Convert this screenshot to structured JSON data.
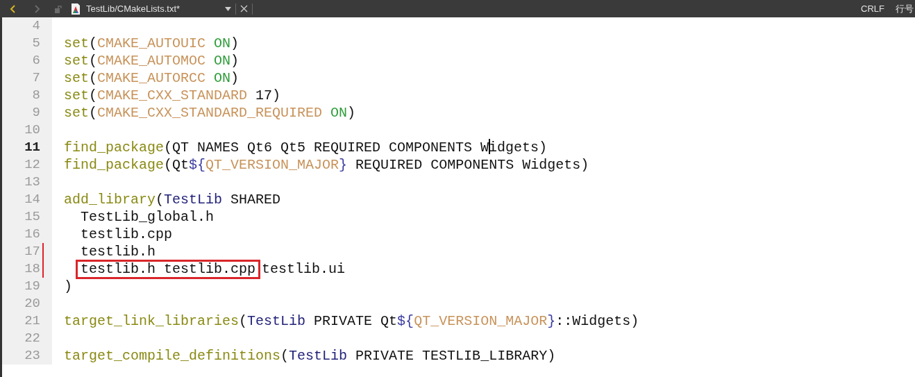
{
  "tab": {
    "title": "TestLib/CMakeLists.txt*",
    "back_enabled": true,
    "forward_enabled": false
  },
  "status": [
    "CRLF",
    "行号"
  ],
  "lines": [
    {
      "number": "4",
      "current": false,
      "changed": false
    },
    {
      "number": "5",
      "current": false,
      "changed": false,
      "tokens": [
        {
          "text": "set",
          "kind": "command"
        },
        {
          "text": "(",
          "kind": "plain"
        },
        {
          "text": "CMAKE_AUTOUIC",
          "kind": "variable"
        },
        {
          "text": " ON",
          "kind": "constant"
        },
        {
          "text": ")",
          "kind": "plain"
        }
      ]
    },
    {
      "number": "6",
      "current": false,
      "changed": false,
      "tokens": [
        {
          "text": "set",
          "kind": "command"
        },
        {
          "text": "(",
          "kind": "plain"
        },
        {
          "text": "CMAKE_AUTOMOC",
          "kind": "variable"
        },
        {
          "text": " ON",
          "kind": "constant"
        },
        {
          "text": ")",
          "kind": "plain"
        }
      ]
    },
    {
      "number": "7",
      "current": false,
      "changed": false,
      "tokens": [
        {
          "text": "set",
          "kind": "command"
        },
        {
          "text": "(",
          "kind": "plain"
        },
        {
          "text": "CMAKE_AUTORCC",
          "kind": "variable"
        },
        {
          "text": " ON",
          "kind": "constant"
        },
        {
          "text": ")",
          "kind": "plain"
        }
      ]
    },
    {
      "number": "8",
      "current": false,
      "changed": false,
      "tokens": [
        {
          "text": "set",
          "kind": "command"
        },
        {
          "text": "(",
          "kind": "plain"
        },
        {
          "text": "CMAKE_CXX_STANDARD",
          "kind": "variable"
        },
        {
          "text": " 17)",
          "kind": "plain"
        }
      ]
    },
    {
      "number": "9",
      "current": false,
      "changed": false,
      "tokens": [
        {
          "text": "set",
          "kind": "command"
        },
        {
          "text": "(",
          "kind": "plain"
        },
        {
          "text": "CMAKE_CXX_STANDARD_REQUIRED",
          "kind": "variable"
        },
        {
          "text": " ON",
          "kind": "constant"
        },
        {
          "text": ")",
          "kind": "plain"
        }
      ]
    },
    {
      "number": "10",
      "current": false,
      "changed": false
    },
    {
      "number": "11",
      "current": true,
      "changed": false,
      "tokens": [
        {
          "text": "find_package",
          "kind": "command"
        },
        {
          "text": "(QT NAMES Qt6 Qt5 REQUIRED COMPONENTS W",
          "kind": "plain"
        },
        {
          "text": "idgets)",
          "kind": "plain",
          "caret_before": true
        }
      ]
    },
    {
      "number": "12",
      "current": false,
      "changed": false,
      "tokens": [
        {
          "text": "find_package",
          "kind": "command"
        },
        {
          "text": "(Qt",
          "kind": "plain"
        },
        {
          "text": "${",
          "kind": "reference"
        },
        {
          "text": "QT_VERSION_MAJOR",
          "kind": "variable"
        },
        {
          "text": "}",
          "kind": "reference"
        },
        {
          "text": " REQUIRED COMPONENTS Widgets)",
          "kind": "plain"
        }
      ]
    },
    {
      "number": "13",
      "current": false,
      "changed": false
    },
    {
      "number": "14",
      "current": false,
      "changed": false,
      "tokens": [
        {
          "text": "add_library",
          "kind": "command"
        },
        {
          "text": "(",
          "kind": "plain"
        },
        {
          "text": "TestLib",
          "kind": "target"
        },
        {
          "text": " SHARED",
          "kind": "plain"
        }
      ]
    },
    {
      "number": "15",
      "current": false,
      "changed": false,
      "indented": true,
      "tokens": [
        {
          "text": "TestLib_global.h",
          "kind": "plain"
        }
      ]
    },
    {
      "number": "16",
      "current": false,
      "changed": false,
      "indented": true,
      "tokens": [
        {
          "text": "testlib.cpp",
          "kind": "plain"
        }
      ]
    },
    {
      "number": "17",
      "current": false,
      "changed": true,
      "indented": true,
      "tokens": [
        {
          "text": "testlib.h",
          "kind": "plain"
        }
      ]
    },
    {
      "number": "18",
      "current": false,
      "changed": true,
      "indented": true,
      "tokens": [
        {
          "text": "testlib.h testlib.cpp",
          "kind": "plain",
          "boxed": true
        },
        {
          "text": "testlib.ui",
          "kind": "plain"
        }
      ]
    },
    {
      "number": "19",
      "current": false,
      "changed": false,
      "tokens": [
        {
          "text": ")",
          "kind": "plain"
        }
      ]
    },
    {
      "number": "20",
      "current": false,
      "changed": false
    },
    {
      "number": "21",
      "current": false,
      "changed": false,
      "tokens": [
        {
          "text": "target_link_libraries",
          "kind": "command"
        },
        {
          "text": "(",
          "kind": "plain"
        },
        {
          "text": "TestLib",
          "kind": "target"
        },
        {
          "text": " PRIVATE Qt",
          "kind": "plain"
        },
        {
          "text": "${",
          "kind": "reference"
        },
        {
          "text": "QT_VERSION_MAJOR",
          "kind": "variable"
        },
        {
          "text": "}",
          "kind": "reference"
        },
        {
          "text": "::Widgets)",
          "kind": "plain"
        }
      ]
    },
    {
      "number": "22",
      "current": false,
      "changed": false
    },
    {
      "number": "23",
      "current": false,
      "changed": false,
      "tokens": [
        {
          "text": "target_compile_definitions",
          "kind": "command"
        },
        {
          "text": "(",
          "kind": "plain"
        },
        {
          "text": "TestLib",
          "kind": "target"
        },
        {
          "text": " PRIVATE TESTLIB_LIBRARY)",
          "kind": "plain"
        }
      ]
    }
  ]
}
